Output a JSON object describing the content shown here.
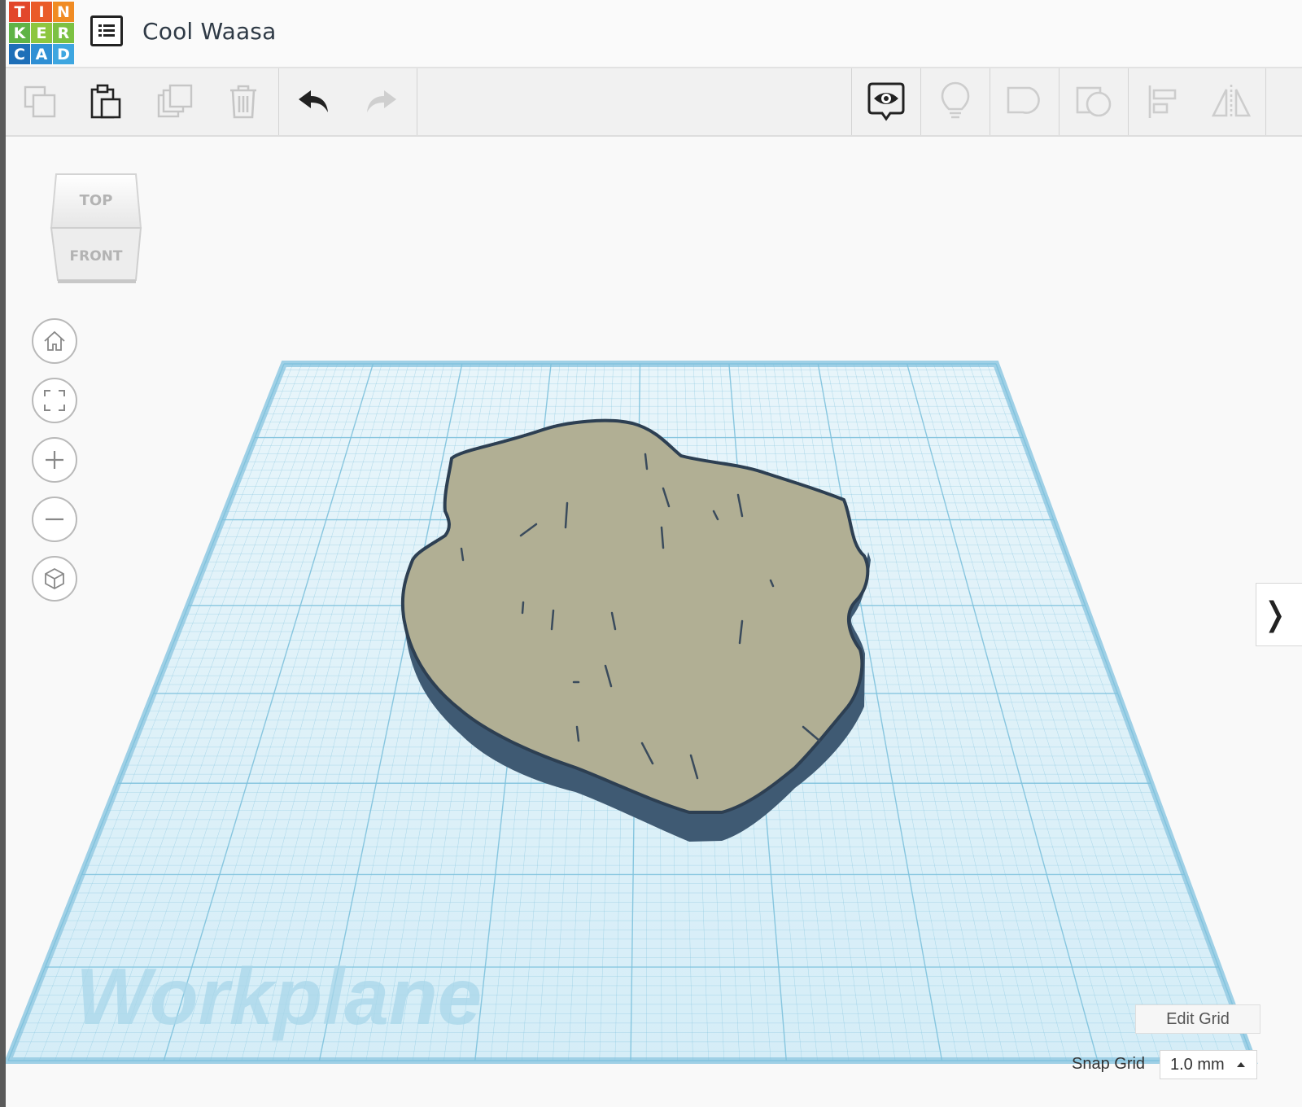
{
  "app": {
    "logo_letters": [
      "T",
      "I",
      "N",
      "K",
      "E",
      "R",
      "C",
      "A",
      "D"
    ],
    "logo_colors": [
      "#e2472b",
      "#e2472b",
      "#f08b23",
      "#8dc63f",
      "#8dc63f",
      "#8dc63f",
      "#1e6fb8",
      "#2f8fd4",
      "#3ea6e0"
    ]
  },
  "header": {
    "title": "Cool Waasa",
    "menu_icon": "list-icon"
  },
  "toolbar": {
    "left_tools": [
      {
        "name": "copy",
        "icon": "copy-icon",
        "enabled": false
      },
      {
        "name": "paste",
        "icon": "paste-icon",
        "enabled": true
      },
      {
        "name": "duplicate",
        "icon": "duplicate-icon",
        "enabled": false
      },
      {
        "name": "delete",
        "icon": "trash-icon",
        "enabled": false
      },
      {
        "name": "undo",
        "icon": "undo-icon",
        "enabled": true
      },
      {
        "name": "redo",
        "icon": "redo-icon",
        "enabled": false
      }
    ],
    "right_tools": [
      {
        "name": "show-all",
        "icon": "eye-bubble-icon",
        "enabled": true
      },
      {
        "name": "hint",
        "icon": "lightbulb-icon",
        "enabled": false
      },
      {
        "name": "group",
        "icon": "group-icon",
        "enabled": false
      },
      {
        "name": "ungroup",
        "icon": "ungroup-icon",
        "enabled": false
      },
      {
        "name": "align",
        "icon": "align-icon",
        "enabled": false
      },
      {
        "name": "mirror",
        "icon": "mirror-icon",
        "enabled": false
      }
    ]
  },
  "viewcube": {
    "top_label": "TOP",
    "front_label": "FRONT"
  },
  "nav_buttons": [
    "home-icon",
    "fit-view-icon",
    "zoom-in-icon",
    "zoom-out-icon",
    "perspective-cube-icon"
  ],
  "workplane": {
    "label": "Workplane",
    "grid_color": "#7fc2dd",
    "surface_color": "#dcf0f8",
    "shape_top_color": "#b1af94",
    "shape_side_color": "#3f5a73"
  },
  "controls": {
    "edit_grid_label": "Edit Grid",
    "snap_grid_label": "Snap Grid",
    "snap_grid_value": "1.0 mm",
    "panel_toggle_glyph": "❭"
  }
}
